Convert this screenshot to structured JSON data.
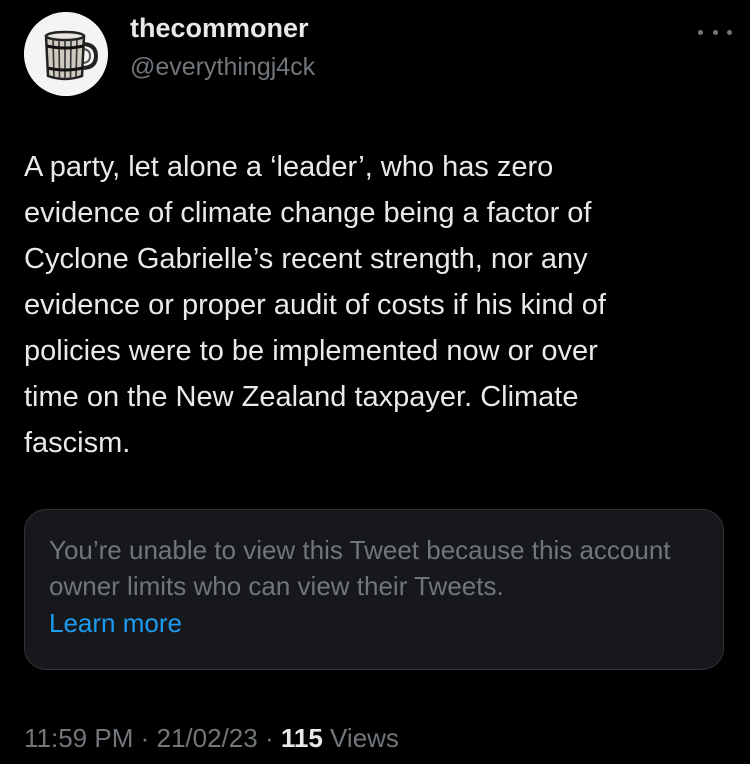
{
  "author": {
    "display_name": "thecommoner",
    "handle": "@everythingj4ck",
    "avatar_icon": "tankard-mug-icon"
  },
  "more_icon": "more-horizontal-icon",
  "tweet": {
    "text": "A party, let alone a ‘leader’, who has zero\nevidence of climate change being a factor of\nCyclone Gabrielle’s recent strength, nor any\nevidence or proper audit of costs if his kind of\npolicies were to be implemented now or over\ntime on the New Zealand taxpayer. Climate\nfascism."
  },
  "quote": {
    "message": "You’re unable to view this Tweet because this account owner limits who can view their Tweets.",
    "link_label": "Learn more"
  },
  "meta": {
    "time": "11:59 PM",
    "separator": "·",
    "date": "21/02/23",
    "views_count": "115",
    "views_label": "Views"
  },
  "colors": {
    "background": "#000000",
    "primary_text": "#e7e9ea",
    "secondary_text": "#71767b",
    "link": "#1d9bf0",
    "card_border": "#2f3336"
  }
}
